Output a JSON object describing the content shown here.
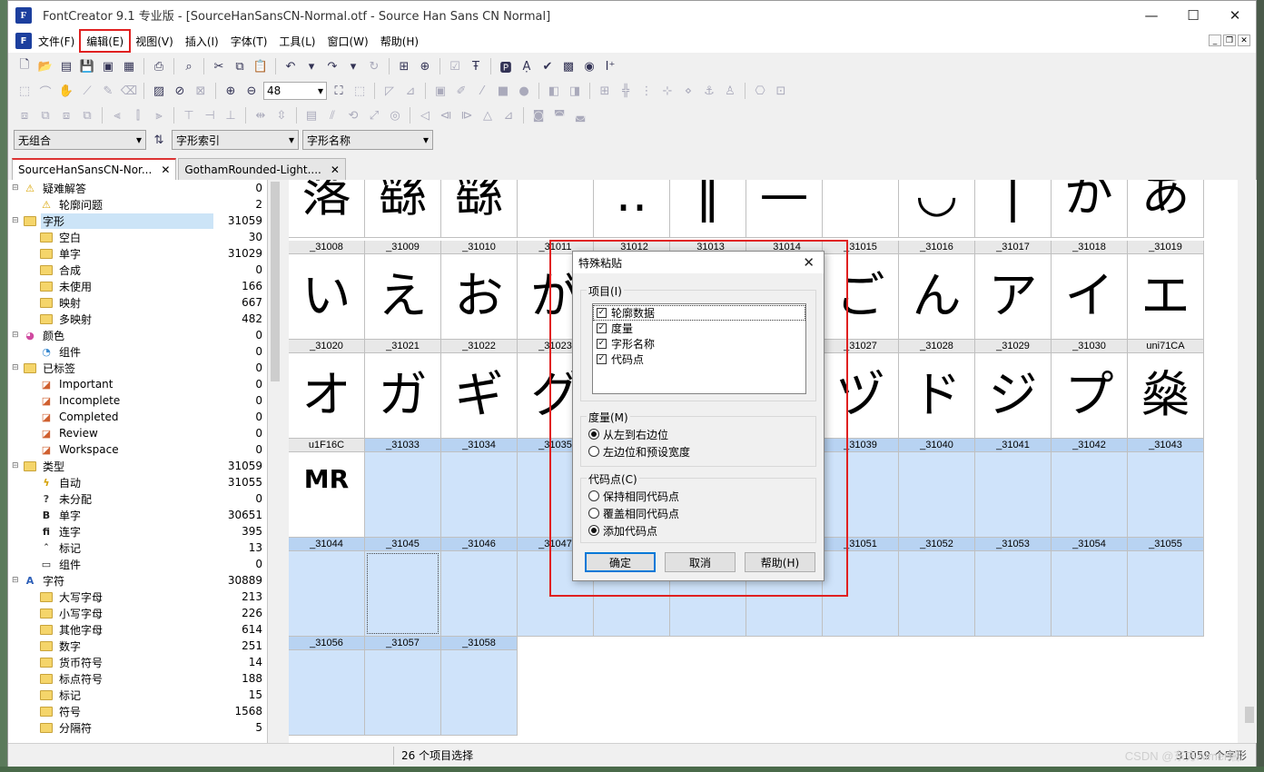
{
  "window": {
    "title": "FontCreator 9.1 专业版  - [SourceHanSansCN-Normal.otf - Source Han Sans CN Normal]",
    "app_icon_text": "F",
    "minimize": "—",
    "maximize": "☐",
    "close": "✕"
  },
  "menu": {
    "items": [
      "文件(F)",
      "编辑(E)",
      "视图(V)",
      "插入(I)",
      "字体(T)",
      "工具(L)",
      "窗口(W)",
      "帮助(H)"
    ],
    "highlighted_index": 1
  },
  "toolbar": {
    "zoom_value": "48"
  },
  "combos": {
    "combination": "无组合",
    "glyph_index": "字形索引",
    "glyph_name": "字形名称"
  },
  "tabs": [
    {
      "label": "SourceHanSansCN-Nor...",
      "active": true
    },
    {
      "label": "GothamRounded-Light....",
      "active": false
    }
  ],
  "tree": [
    {
      "label": "疑难解答",
      "count": "0",
      "icon": "warning-icon",
      "level": 0
    },
    {
      "label": "轮廓问题",
      "count": "2",
      "icon": "warning-icon",
      "level": 1
    },
    {
      "label": "字形",
      "count": "31059",
      "icon": "folder-icon",
      "level": 0,
      "selected": true
    },
    {
      "label": "空白",
      "count": "30",
      "icon": "folder-icon",
      "level": 1
    },
    {
      "label": "单字",
      "count": "31029",
      "icon": "folder-icon",
      "level": 1
    },
    {
      "label": "合成",
      "count": "0",
      "icon": "folder-icon",
      "level": 1
    },
    {
      "label": "未使用",
      "count": "166",
      "icon": "folder-icon",
      "level": 1
    },
    {
      "label": "映射",
      "count": "667",
      "icon": "folder-icon",
      "level": 1
    },
    {
      "label": "多映射",
      "count": "482",
      "icon": "folder-icon",
      "level": 1
    },
    {
      "label": "颜色",
      "count": "0",
      "icon": "color-wheel-icon",
      "level": 0
    },
    {
      "label": "组件",
      "count": "0",
      "icon": "pie-icon",
      "level": 1
    },
    {
      "label": "已标签",
      "count": "0",
      "icon": "folder-icon",
      "level": 0
    },
    {
      "label": "Important",
      "count": "0",
      "icon": "tag-icon",
      "level": 1
    },
    {
      "label": "Incomplete",
      "count": "0",
      "icon": "tag-icon",
      "level": 1
    },
    {
      "label": "Completed",
      "count": "0",
      "icon": "tag-icon",
      "level": 1
    },
    {
      "label": "Review",
      "count": "0",
      "icon": "tag-icon",
      "level": 1
    },
    {
      "label": "Workspace",
      "count": "0",
      "icon": "tag-icon",
      "level": 1
    },
    {
      "label": "类型",
      "count": "31059",
      "icon": "folder-icon",
      "level": 0
    },
    {
      "label": "自动",
      "count": "31055",
      "icon": "lightning-icon",
      "level": 1
    },
    {
      "label": "未分配",
      "count": "0",
      "icon": "question-icon",
      "level": 1
    },
    {
      "label": "单字",
      "count": "30651",
      "icon": "letter-b-icon",
      "level": 1
    },
    {
      "label": "连字",
      "count": "395",
      "icon": "ligature-icon",
      "level": 1
    },
    {
      "label": "标记",
      "count": "13",
      "icon": "caret-icon",
      "level": 1
    },
    {
      "label": "组件",
      "count": "0",
      "icon": "component-icon",
      "level": 1
    },
    {
      "label": "字符",
      "count": "30889",
      "icon": "character-a-icon",
      "level": 0
    },
    {
      "label": "大写字母",
      "count": "213",
      "icon": "folder-icon",
      "level": 1
    },
    {
      "label": "小写字母",
      "count": "226",
      "icon": "folder-icon",
      "level": 1
    },
    {
      "label": "其他字母",
      "count": "614",
      "icon": "folder-icon",
      "level": 1
    },
    {
      "label": "数字",
      "count": "251",
      "icon": "folder-icon",
      "level": 1
    },
    {
      "label": "货币符号",
      "count": "14",
      "icon": "folder-icon",
      "level": 1
    },
    {
      "label": "标点符号",
      "count": "188",
      "icon": "folder-icon",
      "level": 1
    },
    {
      "label": "标记",
      "count": "15",
      "icon": "folder-icon",
      "level": 1
    },
    {
      "label": "符号",
      "count": "1568",
      "icon": "folder-icon",
      "level": 1
    },
    {
      "label": "分隔符",
      "count": "5",
      "icon": "folder-icon",
      "level": 1
    }
  ],
  "grid_rows": [
    {
      "labels": [
        "",
        "",
        "",
        "",
        "",
        "",
        "",
        "",
        "",
        "",
        "",
        ""
      ],
      "glyphs": [
        "落",
        "繇",
        "繇",
        "",
        "‥",
        "‖",
        "—",
        "⁀",
        "◡",
        "|",
        "が",
        "あ"
      ]
    },
    {
      "labels": [
        "_31008",
        "_31009",
        "_31010",
        "_31011",
        "_31012",
        "_31013",
        "_31014",
        "_31015",
        "_31016",
        "_31017",
        "_31018",
        "_31019"
      ],
      "glyphs": [
        "い",
        "え",
        "お",
        "が",
        "",
        "",
        "",
        "ご",
        "ん",
        "ア",
        "イ",
        "エ"
      ]
    },
    {
      "labels": [
        "_31020",
        "_31021",
        "_31022",
        "_31023",
        "",
        "",
        "",
        "_31027",
        "_31028",
        "_31029",
        "_31030",
        "uni71CA"
      ],
      "glyphs": [
        "オ",
        "ガ",
        "ギ",
        "グ",
        "",
        "",
        "",
        "ヅ",
        "ド",
        "ジ",
        "プ",
        "燊"
      ]
    },
    {
      "labels": [
        "u1F16C",
        "_31033",
        "_31034",
        "_31035",
        "",
        "",
        "",
        "_31039",
        "_31040",
        "_31041",
        "_31042",
        "_31043"
      ],
      "glyphs": [
        "MR",
        "",
        "",
        "",
        "",
        "",
        "",
        "",
        "",
        "",
        "",
        ""
      ]
    },
    {
      "labels": [
        "_31044",
        "_31045",
        "_31046",
        "_31047",
        "",
        "",
        "",
        "_31051",
        "_31052",
        "_31053",
        "_31054",
        "_31055"
      ],
      "glyphs": [
        "",
        "",
        "",
        "",
        "",
        "",
        "",
        "",
        "",
        "",
        "",
        ""
      ]
    },
    {
      "labels": [
        "_31056",
        "_31057",
        "_31058"
      ],
      "glyphs": [
        "",
        "",
        ""
      ]
    }
  ],
  "status": {
    "selection": "26 个项目选择",
    "total": "31059 个字形"
  },
  "watermark": "CSDN @东方Aimer瑞.",
  "dialog": {
    "title": "特殊粘贴",
    "items_group": "项目(I)",
    "items": [
      "轮廓数据",
      "度量",
      "字形名称",
      "代码点"
    ],
    "metrics_group": "度量(M)",
    "metrics_options": [
      "从左到右边位",
      "左边位和预设宽度"
    ],
    "metrics_selected": 0,
    "codepoint_group": "代码点(C)",
    "codepoint_options": [
      "保持相同代码点",
      "覆盖相同代码点",
      "添加代码点"
    ],
    "codepoint_selected": 2,
    "ok": "确定",
    "cancel": "取消",
    "help": "帮助(H)"
  },
  "colors": {
    "highlight_red": "#e02020",
    "selection_blue": "#cfe3fa",
    "default_button_border": "#0078d7"
  }
}
